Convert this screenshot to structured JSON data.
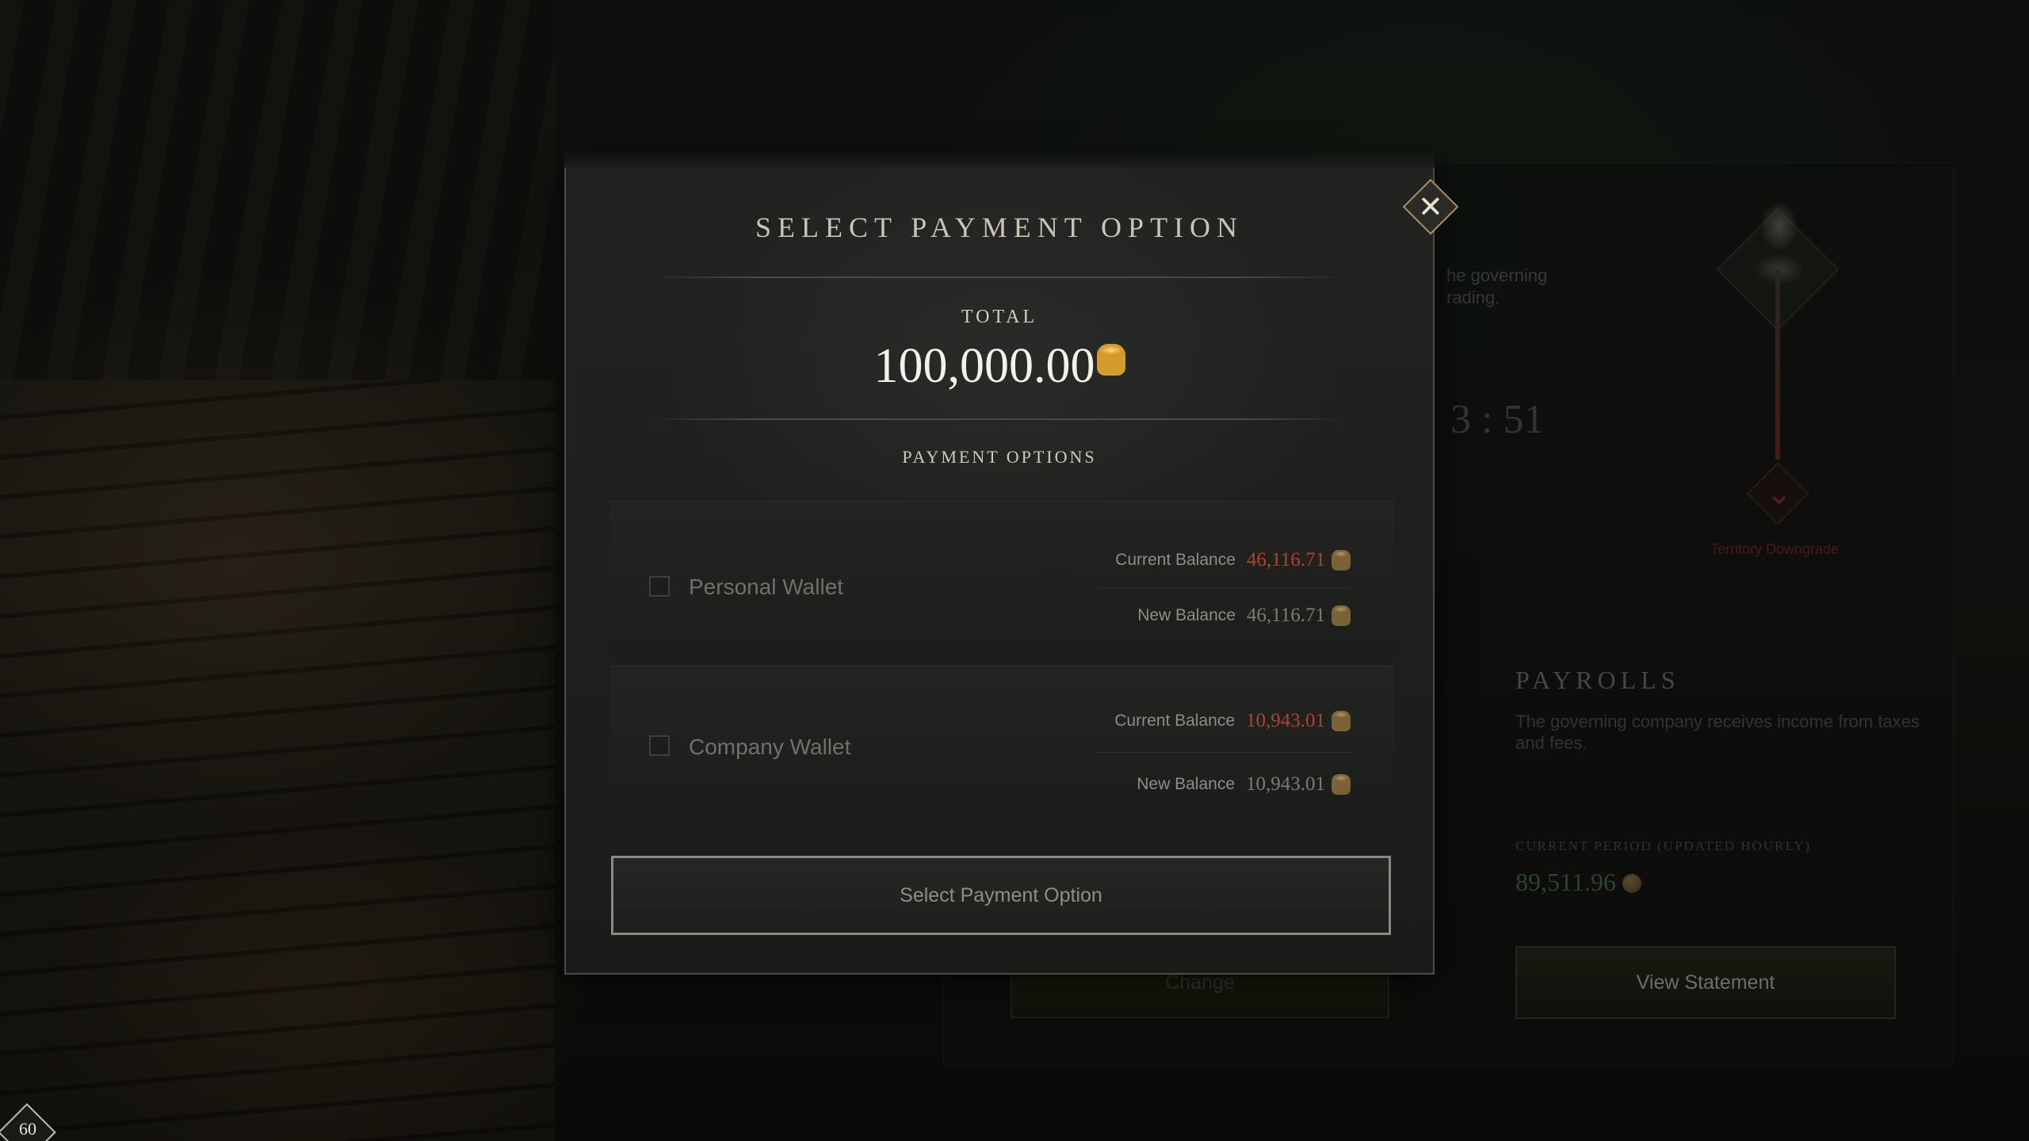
{
  "modal": {
    "title": "SELECT PAYMENT OPTION",
    "close_icon": "close-icon",
    "total_label": "TOTAL",
    "total_amount": "100,000.00",
    "currency_icon": "gold-coin-icon",
    "payment_options_label": "PAYMENT OPTIONS",
    "options": [
      {
        "name": "Personal Wallet",
        "checked": false,
        "current_balance_label": "Current Balance",
        "current_balance": "46,116.71",
        "new_balance_label": "New Balance",
        "new_balance": "46,116.71"
      },
      {
        "name": "Company Wallet",
        "checked": false,
        "current_balance_label": "Current Balance",
        "current_balance": "10,943.01",
        "new_balance_label": "New Balance",
        "new_balance": "10,943.01"
      }
    ],
    "select_button_label": "Select Payment Option"
  },
  "background": {
    "governing_text": "he governing\nrading.",
    "timer": "3 : 51",
    "downgrade_label": "Territory Downgrade",
    "payrolls_title": "PAYROLLS",
    "payrolls_desc": "The governing company receives income from taxes and fees.",
    "period_label": "CURRENT PERIOD (UPDATED HOURLY)",
    "period_value": "89,511.96",
    "view_statement_label": "View Statement",
    "change_label": "Change"
  },
  "hud": {
    "fps": "60"
  },
  "colors": {
    "accent_gold": "#a98e5c",
    "insufficient_red": "#a9452f",
    "period_green": "#3e6a4a"
  }
}
